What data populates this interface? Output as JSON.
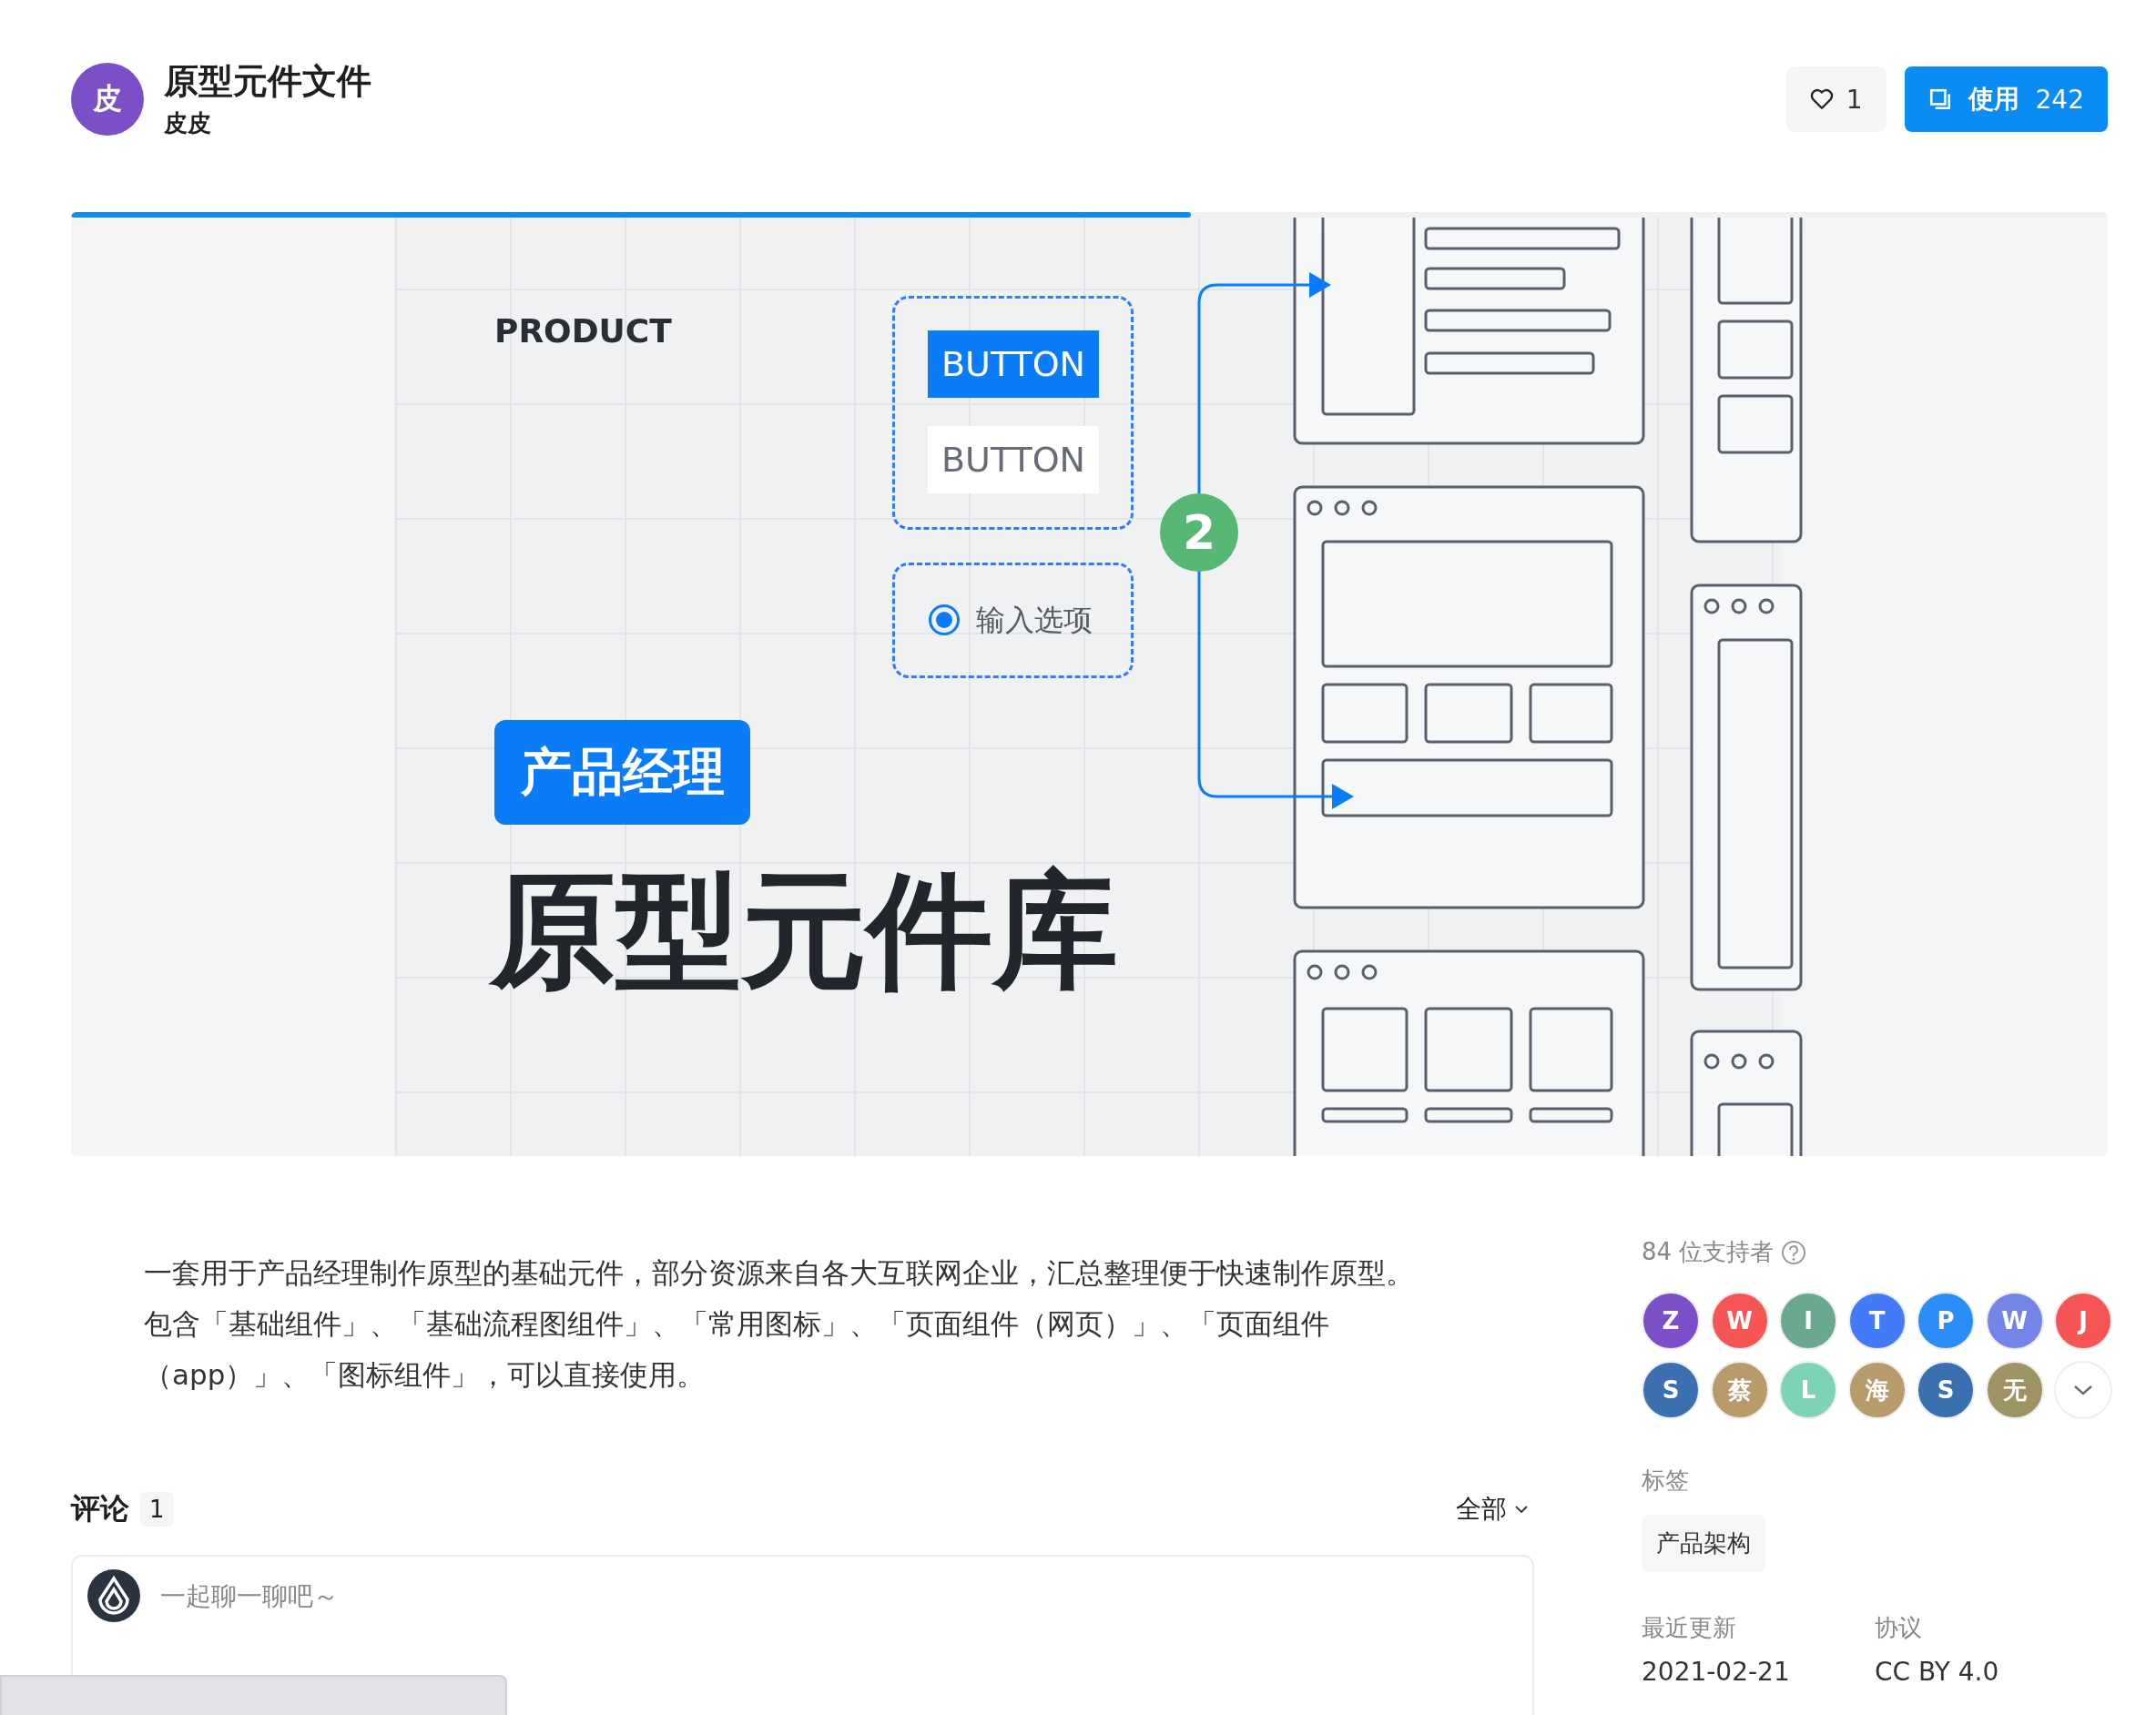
{
  "header": {
    "avatar": "皮",
    "title": "原型元件文件",
    "author": "皮皮",
    "like_count": "1",
    "use_label": "使用",
    "use_count": "242"
  },
  "banner": {
    "loading": {
      "level": 0.55
    },
    "eyebrow": "PRODUCT",
    "buttons": [
      {
        "label": "BUTTON",
        "kind": "primary"
      },
      {
        "label": "BUTTON",
        "kind": "default"
      }
    ],
    "radio": {
      "label": "输入选项",
      "checked": true
    },
    "badge": "产品经理",
    "headline": "原型元件库",
    "step": "2"
  },
  "description": [
    "一套用于产品经理制作原型的基础元件，部分资源来自各大互联网企业，汇总整理便于快速制作原型。",
    "包含「基础组件」、「基础流程图组件」、「常用图标」、「页面组件（网页）」、「页面组件（app）」、「图标组件」，可以直接使用。"
  ],
  "supporters": {
    "label": "84 位支持者",
    "avatars": [
      {
        "initial": "Z",
        "color": "#7b4fc8"
      },
      {
        "initial": "W",
        "color": "#f55555"
      },
      {
        "initial": "I",
        "color": "#6aa88f"
      },
      {
        "initial": "T",
        "color": "#4479f7"
      },
      {
        "initial": "P",
        "color": "#2b8ef8"
      },
      {
        "initial": "W",
        "color": "#7484e8"
      },
      {
        "initial": "J",
        "color": "#f55555"
      },
      {
        "initial": "S",
        "color": "#3a6fb0"
      },
      {
        "initial": "蔡",
        "color": "#b89b6a"
      },
      {
        "initial": "L",
        "color": "#7dd3b8"
      },
      {
        "initial": "海",
        "color": "#b89b6a"
      },
      {
        "initial": "S",
        "color": "#3a6fb0"
      },
      {
        "initial": "无",
        "color": "#9e9362"
      }
    ]
  },
  "tags": {
    "label": "标签",
    "items": [
      "产品架构"
    ]
  },
  "meta": [
    {
      "label": "最近更新",
      "value": "2021-02-21"
    },
    {
      "label": "协议",
      "value": "CC BY 4.0"
    }
  ],
  "comments": {
    "title": "评论",
    "count": "1",
    "filter": "全部",
    "placeholder": "一起聊一聊吧～"
  }
}
